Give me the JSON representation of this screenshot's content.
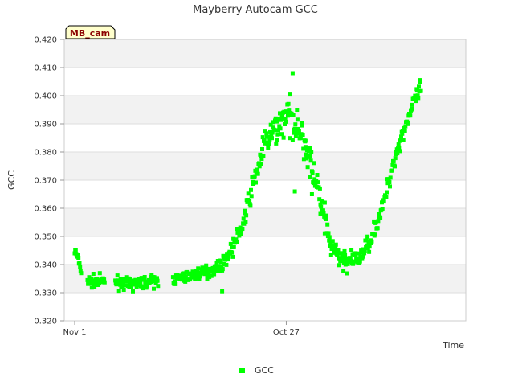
{
  "chart_data": {
    "type": "scatter",
    "title": "Mayberry Autocam GCC",
    "xlabel": "Time",
    "ylabel": "GCC",
    "ylim": [
      0.32,
      0.42
    ],
    "y_ticks": [
      "0.320",
      "0.330",
      "0.340",
      "0.350",
      "0.360",
      "0.370",
      "0.380",
      "0.390",
      "0.400",
      "0.410",
      "0.420"
    ],
    "x_tick_labels": [
      "Nov 1",
      "Oct 27"
    ],
    "x_day_range": [
      1,
      173
    ],
    "x_tick_days": [
      1,
      100
    ],
    "grid": true,
    "legend": {
      "position": "bottom",
      "entries": [
        "GCC"
      ]
    },
    "badge": "MB_cam",
    "color": "#00ff00",
    "trend": [
      [
        1,
        0.345
      ],
      [
        2,
        0.343
      ],
      [
        3,
        0.341
      ],
      [
        5,
        0.334
      ],
      [
        10,
        0.334
      ],
      [
        15,
        0.334
      ],
      [
        20,
        0.334
      ],
      [
        25,
        0.333
      ],
      [
        30,
        0.333
      ],
      [
        35,
        0.334
      ],
      [
        40,
        0.334
      ],
      [
        50,
        0.335
      ],
      [
        55,
        0.336
      ],
      [
        60,
        0.337
      ],
      [
        65,
        0.338
      ],
      [
        70,
        0.34
      ],
      [
        75,
        0.346
      ],
      [
        80,
        0.355
      ],
      [
        85,
        0.37
      ],
      [
        90,
        0.383
      ],
      [
        95,
        0.388
      ],
      [
        100,
        0.393
      ],
      [
        105,
        0.39
      ],
      [
        110,
        0.38
      ],
      [
        115,
        0.366
      ],
      [
        120,
        0.348
      ],
      [
        125,
        0.342
      ],
      [
        130,
        0.341
      ],
      [
        135,
        0.343
      ],
      [
        140,
        0.35
      ],
      [
        145,
        0.36
      ],
      [
        150,
        0.376
      ],
      [
        155,
        0.388
      ],
      [
        160,
        0.398
      ],
      [
        163,
        0.403
      ]
    ],
    "gaps": [
      [
        4,
        7
      ],
      [
        15,
        20
      ],
      [
        40,
        47
      ]
    ],
    "noise": [
      [
        1,
        0.002
      ],
      [
        70,
        0.002
      ],
      [
        86,
        0.004
      ],
      [
        100,
        0.006
      ],
      [
        115,
        0.006
      ],
      [
        120,
        0.004
      ],
      [
        140,
        0.003
      ],
      [
        163,
        0.003
      ]
    ],
    "outliers": [
      [
        103,
        0.408
      ],
      [
        104,
        0.366
      ],
      [
        111,
        0.371
      ],
      [
        112,
        0.365
      ],
      [
        105,
        0.395
      ],
      [
        109,
        0.384
      ],
      [
        116,
        0.358
      ],
      [
        118,
        0.362
      ],
      [
        70,
        0.3305
      ],
      [
        63,
        0.335
      ]
    ]
  }
}
